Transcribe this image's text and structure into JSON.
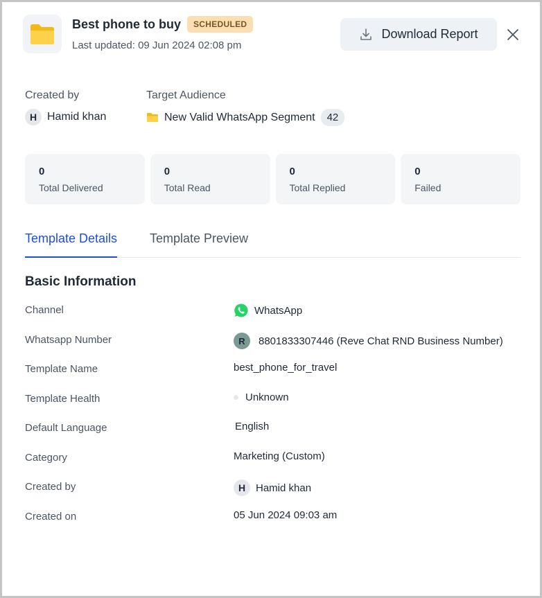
{
  "header": {
    "title": "Best phone to buy",
    "status_badge": "SCHEDULED",
    "last_updated": "Last updated: 09 Jun 2024 02:08 pm",
    "download_label": "Download Report"
  },
  "meta": {
    "created_by_label": "Created by",
    "created_by_initial": "H",
    "created_by_name": "Hamid khan",
    "audience_label": "Target Audience",
    "audience_name": "New Valid WhatsApp Segment",
    "audience_count": "42"
  },
  "stats": [
    {
      "value": "0",
      "label": "Total Delivered"
    },
    {
      "value": "0",
      "label": "Total Read"
    },
    {
      "value": "0",
      "label": "Total Replied"
    },
    {
      "value": "0",
      "label": "Failed"
    }
  ],
  "tabs": {
    "details": "Template Details",
    "preview": "Template Preview"
  },
  "basic_info": {
    "title": "Basic Information",
    "rows": [
      {
        "label": "Channel",
        "value": "WhatsApp"
      },
      {
        "label": "Whatsapp Number",
        "value": "8801833307446 (Reve Chat RND Business Number)",
        "avatar": "R"
      },
      {
        "label": "Template Name",
        "value": "best_phone_for_travel"
      },
      {
        "label": "Template Health",
        "value": "Unknown"
      },
      {
        "label": "Default Language",
        "value": "English"
      },
      {
        "label": "Category",
        "value": "Marketing (Custom)"
      },
      {
        "label": "Created by",
        "value": "Hamid khan",
        "avatar": "H"
      },
      {
        "label": "Created on",
        "value": "05 Jun 2024 09:03 am"
      }
    ]
  },
  "colors": {
    "accent": "#1d4ed8",
    "badge_bg": "#fbdfb2",
    "whatsapp": "#25d366",
    "folder": "#fbc02d"
  }
}
